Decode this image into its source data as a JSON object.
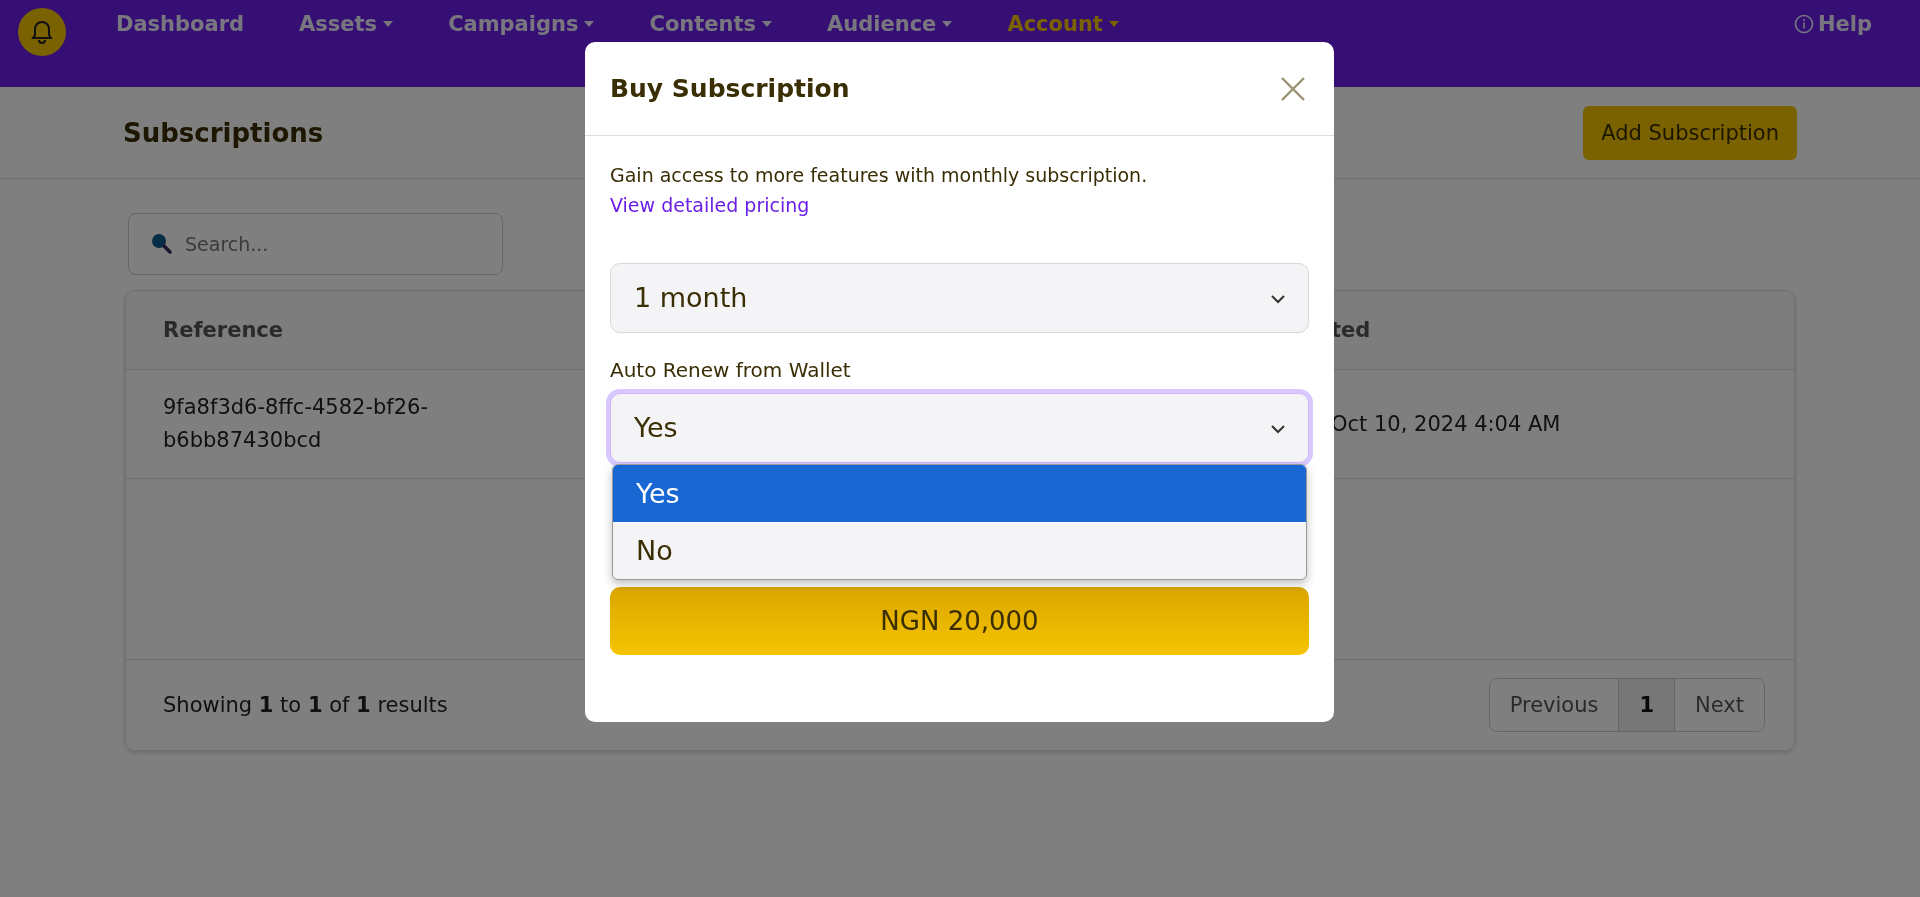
{
  "nav": {
    "items": [
      {
        "label": "Dashboard",
        "dropdown": false,
        "selected": false
      },
      {
        "label": "Assets",
        "dropdown": true,
        "selected": false
      },
      {
        "label": "Campaigns",
        "dropdown": true,
        "selected": false
      },
      {
        "label": "Contents",
        "dropdown": true,
        "selected": false
      },
      {
        "label": "Audience",
        "dropdown": true,
        "selected": false
      },
      {
        "label": "Account",
        "dropdown": true,
        "selected": true
      }
    ],
    "help": "Help"
  },
  "page": {
    "title": "Subscriptions",
    "add_button": "Add Subscription"
  },
  "search": {
    "placeholder": "Search..."
  },
  "table": {
    "columns": [
      "Reference",
      "ted"
    ],
    "rows": [
      {
        "reference": "9fa8f3d6-8ffc-4582-bf26-b6bb87430bcd",
        "date": "Oct 10, 2024 4:04 AM"
      }
    ]
  },
  "footer": {
    "summary": "Showing **1** to **1** of **1** results",
    "pages": [
      {
        "label": "Previous",
        "selected": false
      },
      {
        "label": "1",
        "selected": true
      },
      {
        "label": "Next",
        "selected": false
      }
    ]
  },
  "modal": {
    "title": "Buy Subscription",
    "intro": "Gain access to more features with monthly subscription.",
    "link": "View detailed pricing",
    "duration": {
      "value": "1 month"
    },
    "auto_renew": {
      "label": "Auto Renew from Wallet",
      "value": "Yes",
      "expanded": true,
      "options": [
        {
          "label": "Yes",
          "selected": true
        },
        {
          "label": "No",
          "selected": false
        }
      ]
    },
    "pay_button": "NGN 20,000"
  }
}
